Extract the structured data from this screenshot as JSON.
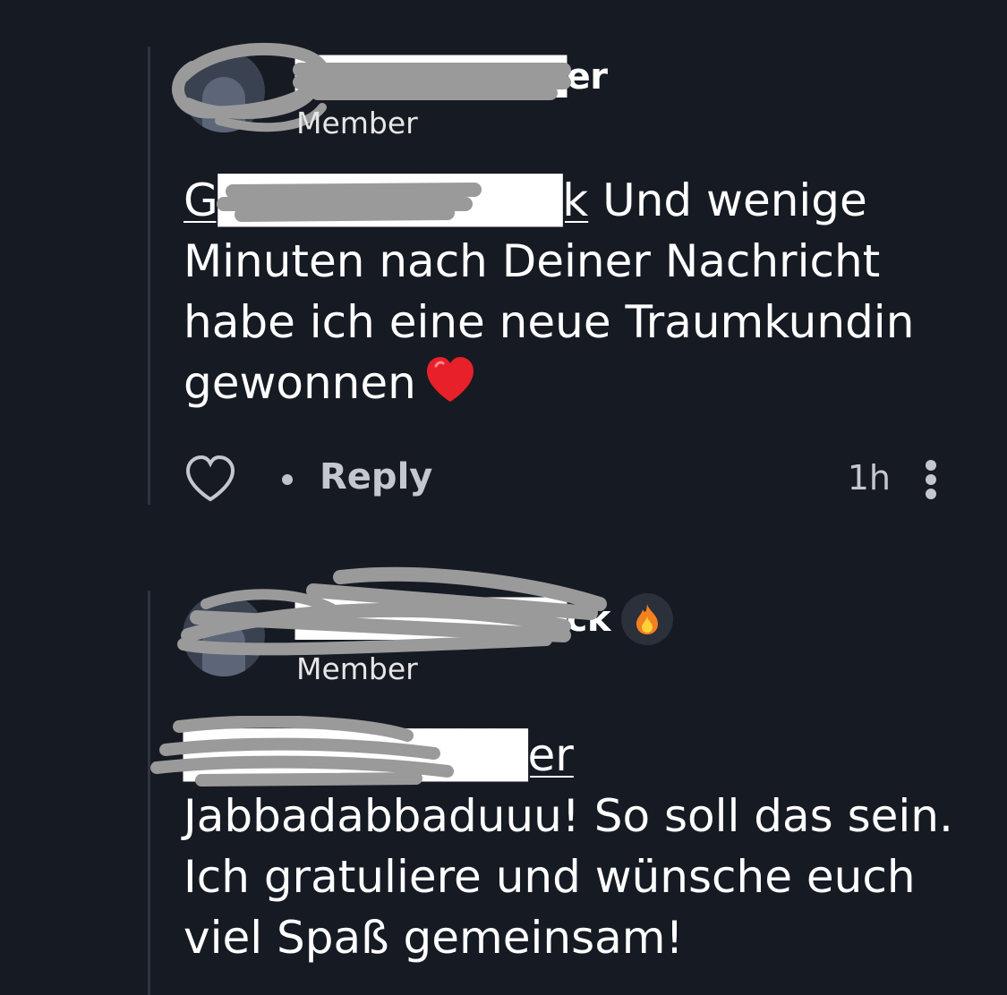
{
  "comments": [
    {
      "author_name": "██████████er",
      "role": "Member",
      "mention": "G██████████k",
      "text": " Und wenige Minuten nach Deiner Nachricht habe ich eine neue Traumkundin gewonnen",
      "emoji": "red-heart",
      "reply_label": "Reply",
      "timestamp": "1h"
    },
    {
      "author_name": "██████████ck",
      "role": "Member",
      "badge_icon": "fire-icon",
      "mention": "██████████er",
      "text": " Jabbadabbaduuu! So soll das sein. Ich gratuliere und wünsche euch viel Spaß gemeinsam!"
    }
  ],
  "colors": {
    "background": "#161a23",
    "text": "#ffffff",
    "muted": "#c4c7cf",
    "thread_line": "#2f3440",
    "redaction": "#9a9a9a"
  }
}
